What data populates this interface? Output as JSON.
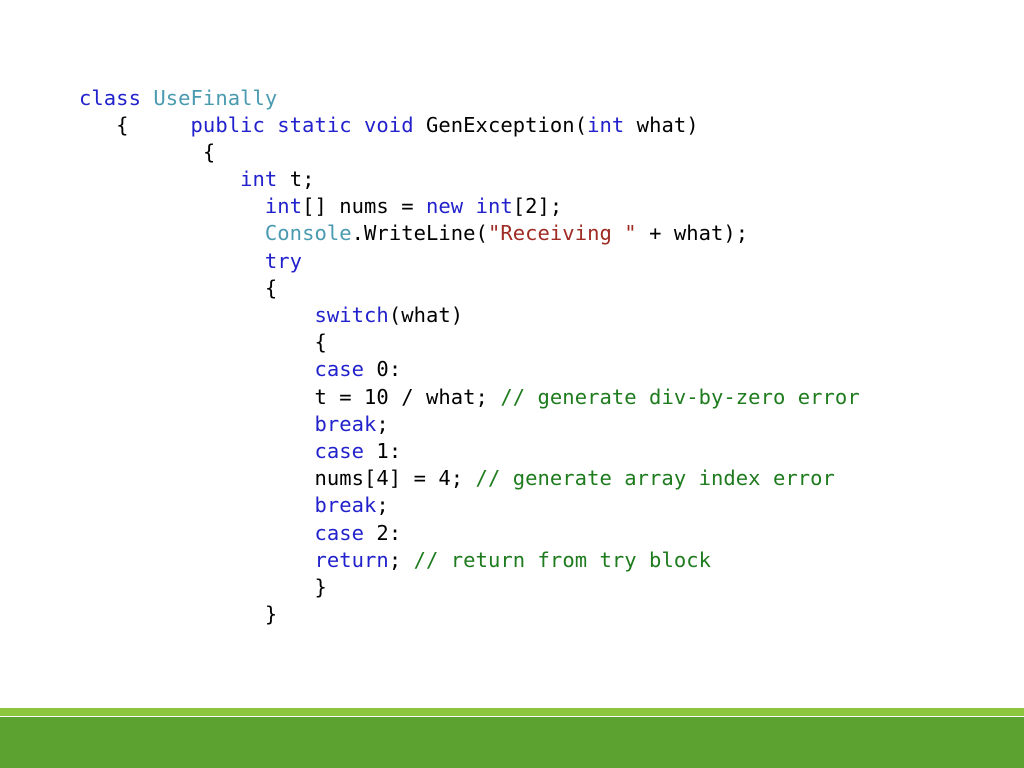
{
  "slide": {
    "background_color": "#ffffff",
    "title": "",
    "code_language": "csharp"
  },
  "colors": {
    "keyword": "#2222CC",
    "type": "#4A9AB0",
    "string": "#9E2B24",
    "comment": "#1E7B1E",
    "plain": "#000000",
    "bar_light_green": "#8CC63E",
    "bar_dark_green": "#5CA231"
  },
  "code": {
    "lines": [
      {
        "indent": 0,
        "tokens": [
          {
            "text": "class ",
            "kind": "keyword"
          },
          {
            "text": "UseFinally",
            "kind": "type"
          }
        ]
      },
      {
        "indent": 0,
        "tokens": [
          {
            "text": "   {     ",
            "kind": "plain"
          },
          {
            "text": "public static void ",
            "kind": "keyword"
          },
          {
            "text": "GenException(",
            "kind": "plain"
          },
          {
            "text": "int",
            "kind": "keyword"
          },
          {
            "text": " what)",
            "kind": "plain"
          }
        ]
      },
      {
        "indent": 0,
        "tokens": [
          {
            "text": "          {",
            "kind": "plain"
          }
        ]
      },
      {
        "indent": 0,
        "tokens": [
          {
            "text": "             ",
            "kind": "plain"
          },
          {
            "text": "int",
            "kind": "keyword"
          },
          {
            "text": " t;",
            "kind": "plain"
          }
        ]
      },
      {
        "indent": 0,
        "tokens": [
          {
            "text": "               ",
            "kind": "plain"
          },
          {
            "text": "int",
            "kind": "keyword"
          },
          {
            "text": "[] nums = ",
            "kind": "plain"
          },
          {
            "text": "new int",
            "kind": "keyword"
          },
          {
            "text": "[2];",
            "kind": "plain"
          }
        ]
      },
      {
        "indent": 0,
        "tokens": [
          {
            "text": "               ",
            "kind": "plain"
          },
          {
            "text": "Console",
            "kind": "type"
          },
          {
            "text": ".WriteLine(",
            "kind": "plain"
          },
          {
            "text": "\"Receiving \"",
            "kind": "string"
          },
          {
            "text": " + what);",
            "kind": "plain"
          }
        ]
      },
      {
        "indent": 0,
        "tokens": [
          {
            "text": "               ",
            "kind": "plain"
          },
          {
            "text": "try",
            "kind": "keyword"
          }
        ]
      },
      {
        "indent": 0,
        "tokens": [
          {
            "text": "               {",
            "kind": "plain"
          }
        ]
      },
      {
        "indent": 0,
        "tokens": [
          {
            "text": "                   ",
            "kind": "plain"
          },
          {
            "text": "switch",
            "kind": "keyword"
          },
          {
            "text": "(what)",
            "kind": "plain"
          }
        ]
      },
      {
        "indent": 0,
        "tokens": [
          {
            "text": "                   {",
            "kind": "plain"
          }
        ]
      },
      {
        "indent": 0,
        "tokens": [
          {
            "text": "                   ",
            "kind": "plain"
          },
          {
            "text": "case",
            "kind": "keyword"
          },
          {
            "text": " 0:",
            "kind": "plain"
          }
        ]
      },
      {
        "indent": 0,
        "tokens": [
          {
            "text": "                   t = 10 / what; ",
            "kind": "plain"
          },
          {
            "text": "// generate div-by-zero error",
            "kind": "comment"
          }
        ]
      },
      {
        "indent": 0,
        "tokens": [
          {
            "text": "                   ",
            "kind": "plain"
          },
          {
            "text": "break",
            "kind": "keyword"
          },
          {
            "text": ";",
            "kind": "plain"
          }
        ]
      },
      {
        "indent": 0,
        "tokens": [
          {
            "text": "                   ",
            "kind": "plain"
          },
          {
            "text": "case",
            "kind": "keyword"
          },
          {
            "text": " 1:",
            "kind": "plain"
          }
        ]
      },
      {
        "indent": 0,
        "tokens": [
          {
            "text": "                   nums[4] = 4; ",
            "kind": "plain"
          },
          {
            "text": "// generate array index error",
            "kind": "comment"
          }
        ]
      },
      {
        "indent": 0,
        "tokens": [
          {
            "text": "                   ",
            "kind": "plain"
          },
          {
            "text": "break",
            "kind": "keyword"
          },
          {
            "text": ";",
            "kind": "plain"
          }
        ]
      },
      {
        "indent": 0,
        "tokens": [
          {
            "text": "                   ",
            "kind": "plain"
          },
          {
            "text": "case",
            "kind": "keyword"
          },
          {
            "text": " 2:",
            "kind": "plain"
          }
        ]
      },
      {
        "indent": 0,
        "tokens": [
          {
            "text": "                   ",
            "kind": "plain"
          },
          {
            "text": "return",
            "kind": "keyword"
          },
          {
            "text": "; ",
            "kind": "plain"
          },
          {
            "text": "// return from try block",
            "kind": "comment"
          }
        ]
      },
      {
        "indent": 0,
        "tokens": [
          {
            "text": "                   }",
            "kind": "plain"
          }
        ]
      },
      {
        "indent": 0,
        "tokens": [
          {
            "text": "               }",
            "kind": "plain"
          }
        ]
      }
    ],
    "plain_text": "class UseFinally\n   {     public static void GenException(int what)\n          {\n             int t;\n               int[] nums = new int[2];\n               Console.WriteLine(\"Receiving \" + what);\n               try\n               {\n                   switch(what)\n                   {\n                   case 0:\n                   t = 10 / what; // generate div-by-zero error\n                   break;\n                   case 1:\n                   nums[4] = 4; // generate array index error\n                   break;\n                   case 2:\n                   return; // return from try block\n                   }\n               }"
  }
}
